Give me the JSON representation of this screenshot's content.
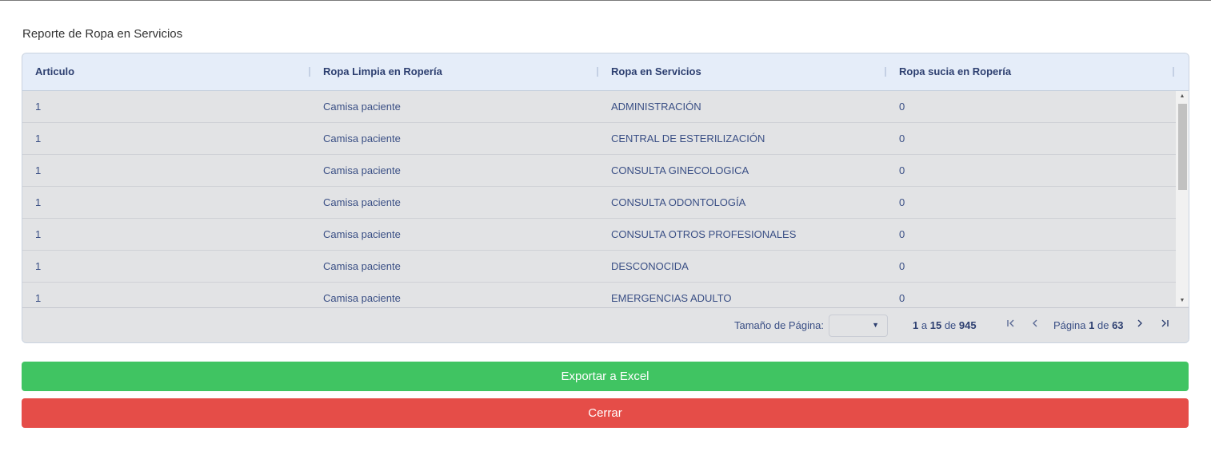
{
  "modal": {
    "title": "Reporte de Ropa en Servicios"
  },
  "grid": {
    "columns": [
      "Articulo",
      "Ropa Limpia en Ropería",
      "Ropa en Servicios",
      "Ropa sucia en Ropería"
    ],
    "rows": [
      [
        "1",
        "Camisa paciente",
        "ADMINISTRACIÓN",
        "0"
      ],
      [
        "1",
        "Camisa paciente",
        "CENTRAL DE ESTERILIZACIÓN",
        "0"
      ],
      [
        "1",
        "Camisa paciente",
        "CONSULTA GINECOLOGICA",
        "0"
      ],
      [
        "1",
        "Camisa paciente",
        "CONSULTA ODONTOLOGÍA",
        "0"
      ],
      [
        "1",
        "Camisa paciente",
        "CONSULTA OTROS PROFESIONALES",
        "0"
      ],
      [
        "1",
        "Camisa paciente",
        "DESCONOCIDA",
        "0"
      ],
      [
        "1",
        "Camisa paciente",
        "EMERGENCIAS ADULTO",
        "0"
      ]
    ],
    "footer": {
      "page_size_label": "Tamaño de Página:",
      "page_size_value": "",
      "row_from": "1",
      "row_to_word": "a",
      "row_to": "15",
      "row_of_word": "de",
      "row_total": "945",
      "page_word": "Página",
      "page_current": "1",
      "page_of_word": "de",
      "page_total": "63",
      "first_icon": "first-page-icon",
      "prev_icon": "previous-page-icon",
      "next_icon": "next-page-icon",
      "last_icon": "last-page-icon"
    }
  },
  "actions": {
    "export_label": "Exportar a Excel",
    "close_label": "Cerrar"
  },
  "colors": {
    "export_button": "#40c462",
    "close_button": "#e54d48",
    "header_bg": "#e5edf9",
    "row_bg": "#e2e3e5",
    "cell_text": "#3a4f85"
  }
}
